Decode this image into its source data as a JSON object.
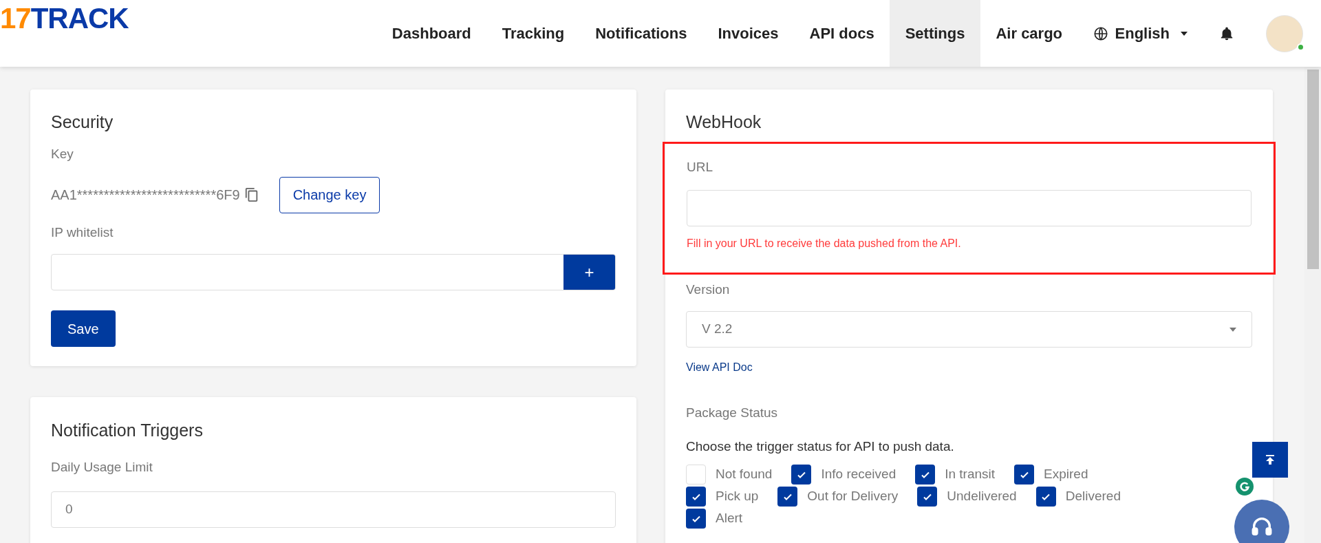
{
  "logo": {
    "digits": "17",
    "name": "TRACK"
  },
  "nav": [
    {
      "label": "Dashboard",
      "selected": false
    },
    {
      "label": "Tracking",
      "selected": false
    },
    {
      "label": "Notifications",
      "selected": false
    },
    {
      "label": "Invoices",
      "selected": false
    },
    {
      "label": "API docs",
      "selected": false
    },
    {
      "label": "Settings",
      "selected": true
    },
    {
      "label": "Air cargo",
      "selected": false
    }
  ],
  "language": "English",
  "user": {
    "online": true
  },
  "security": {
    "title": "Security",
    "key_label": "Key",
    "key_value": "AA1**************************6F9",
    "change_button": "Change key",
    "whitelist_label": "IP whitelist",
    "add_button": "+",
    "save_button": "Save"
  },
  "notification_triggers": {
    "title": "Notification Triggers",
    "limit_label": "Daily Usage Limit",
    "limit_value": "0"
  },
  "webhook": {
    "title": "WebHook",
    "url_label": "URL",
    "url_highlighted": true,
    "url_error": "Fill in your URL to receive the data pushed from the API.",
    "version_label": "Version",
    "version_value": "V 2.2",
    "doc_link": "View API Doc",
    "status_label": "Package Status",
    "status_hint": "Choose the trigger status for API to push data.",
    "statuses": [
      {
        "label": "Not found",
        "checked": false
      },
      {
        "label": "Info received",
        "checked": true
      },
      {
        "label": "In transit",
        "checked": true
      },
      {
        "label": "Expired",
        "checked": true
      },
      {
        "label": "Pick up",
        "checked": true
      },
      {
        "label": "Out for Delivery",
        "checked": true
      },
      {
        "label": "Undelivered",
        "checked": true
      },
      {
        "label": "Delivered",
        "checked": true
      },
      {
        "label": "Alert",
        "checked": true
      }
    ]
  }
}
